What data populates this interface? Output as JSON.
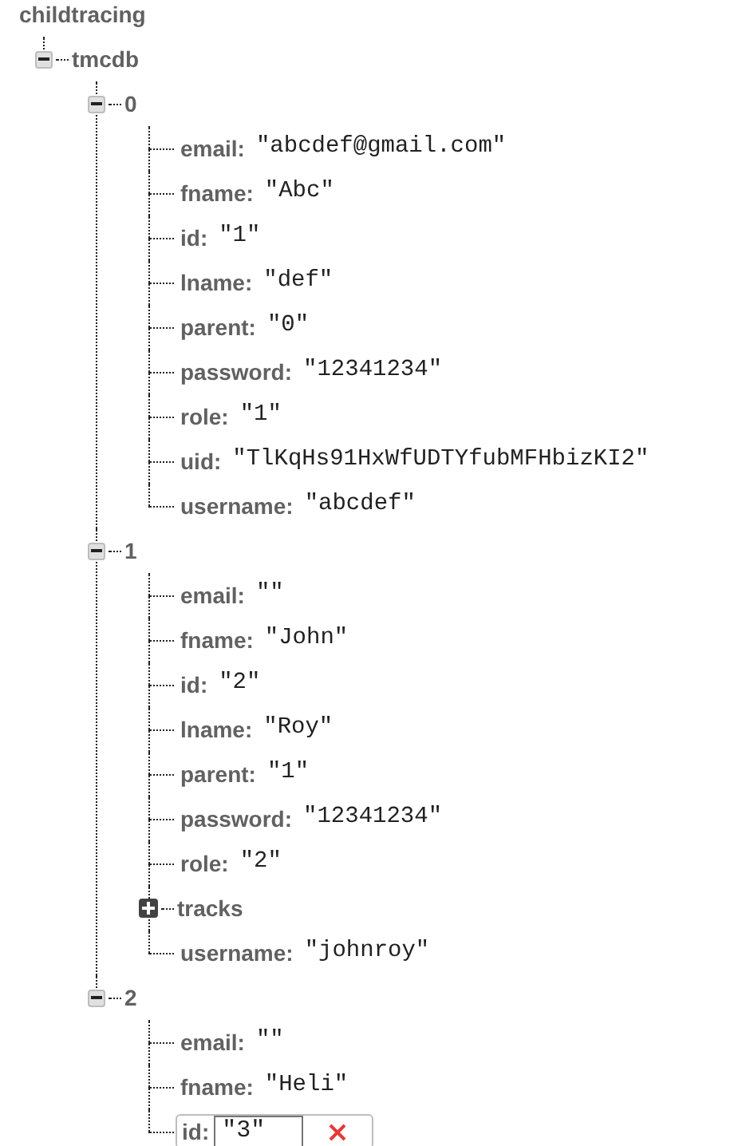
{
  "root": {
    "label": "childtracing",
    "children": [
      {
        "key": "tmcdb",
        "expanded": true,
        "children": [
          {
            "key": "0",
            "expanded": true,
            "children": [
              {
                "key": "email:",
                "value": "\"abcdef@gmail.com\""
              },
              {
                "key": "fname:",
                "value": "\"Abc\""
              },
              {
                "key": "id:",
                "value": "\"1\""
              },
              {
                "key": "lname:",
                "value": "\"def\""
              },
              {
                "key": "parent:",
                "value": "\"0\""
              },
              {
                "key": "password:",
                "value": "\"12341234\""
              },
              {
                "key": "role:",
                "value": "\"1\""
              },
              {
                "key": "uid:",
                "value": "\"TlKqHs91HxWfUDTYfubMFHbizKI2\""
              },
              {
                "key": "username:",
                "value": "\"abcdef\""
              }
            ]
          },
          {
            "key": "1",
            "expanded": true,
            "children": [
              {
                "key": "email:",
                "value": "\"\""
              },
              {
                "key": "fname:",
                "value": "\"John\""
              },
              {
                "key": "id:",
                "value": "\"2\""
              },
              {
                "key": "lname:",
                "value": "\"Roy\""
              },
              {
                "key": "parent:",
                "value": "\"1\""
              },
              {
                "key": "password:",
                "value": "\"12341234\""
              },
              {
                "key": "role:",
                "value": "\"2\""
              },
              {
                "key": "tracks",
                "expanded": false
              },
              {
                "key": "username:",
                "value": "\"johnroy\""
              }
            ]
          },
          {
            "key": "2",
            "expanded": true,
            "children": [
              {
                "key": "email:",
                "value": "\"\""
              },
              {
                "key": "fname:",
                "value": "\"Heli\""
              },
              {
                "key": "id:",
                "value": "\"3\"",
                "editing": true
              }
            ]
          }
        ]
      }
    ]
  }
}
